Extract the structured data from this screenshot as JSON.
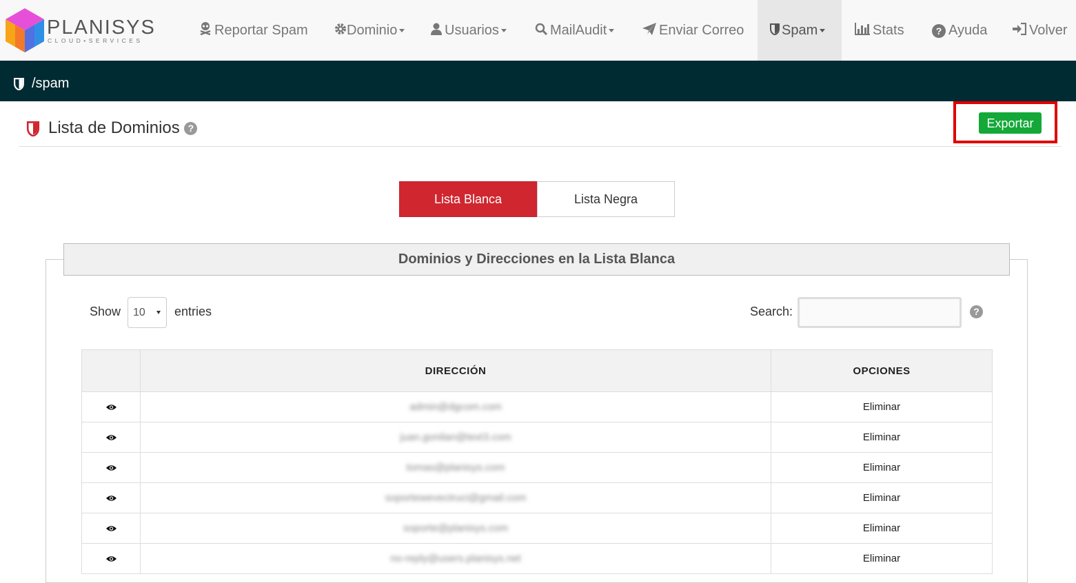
{
  "brand": {
    "name": "PLANISYS",
    "tagline": "CLOUD•SERVICES"
  },
  "nav": {
    "reportar": "Reportar Spam",
    "dominio": "Dominio",
    "usuarios": "Usuarios",
    "mailaudit": "MailAudit",
    "enviar": "Enviar Correo",
    "spam": "Spam",
    "stats": "Stats",
    "ayuda": "Ayuda",
    "volver": "Volver"
  },
  "breadcrumb": "/spam",
  "page": {
    "title": "Lista de Dominios",
    "help": "?",
    "export_label": "Exportar"
  },
  "tabs": {
    "blanca": "Lista Blanca",
    "negra": "Lista Negra"
  },
  "panel": {
    "title": "Dominios y Direcciones en la Lista Blanca"
  },
  "controls": {
    "show": "Show",
    "entries_value": "10",
    "entries": "entries",
    "search": "Search:",
    "search_value": "",
    "help": "?"
  },
  "table": {
    "headers": {
      "dir": "DIRECCIÓN",
      "opt": "OPCIONES"
    },
    "rows": [
      {
        "addr": "admin@dgcom.com",
        "opt": "Eliminar"
      },
      {
        "addr": "juan.gonilan@text3.com",
        "opt": "Eliminar"
      },
      {
        "addr": "tomas@planisys.com",
        "opt": "Eliminar"
      },
      {
        "addr": "soportewevectruci@gmail.com",
        "opt": "Eliminar"
      },
      {
        "addr": "soporte@planisys.com",
        "opt": "Eliminar"
      },
      {
        "addr": "no-reply@users.planisys.net",
        "opt": "Eliminar"
      }
    ]
  },
  "colors": {
    "navbar": "#f8f8f8",
    "bar": "#002b33",
    "active_tab": "#d0262f",
    "export": "#14a839",
    "highlight": "#e00000"
  }
}
